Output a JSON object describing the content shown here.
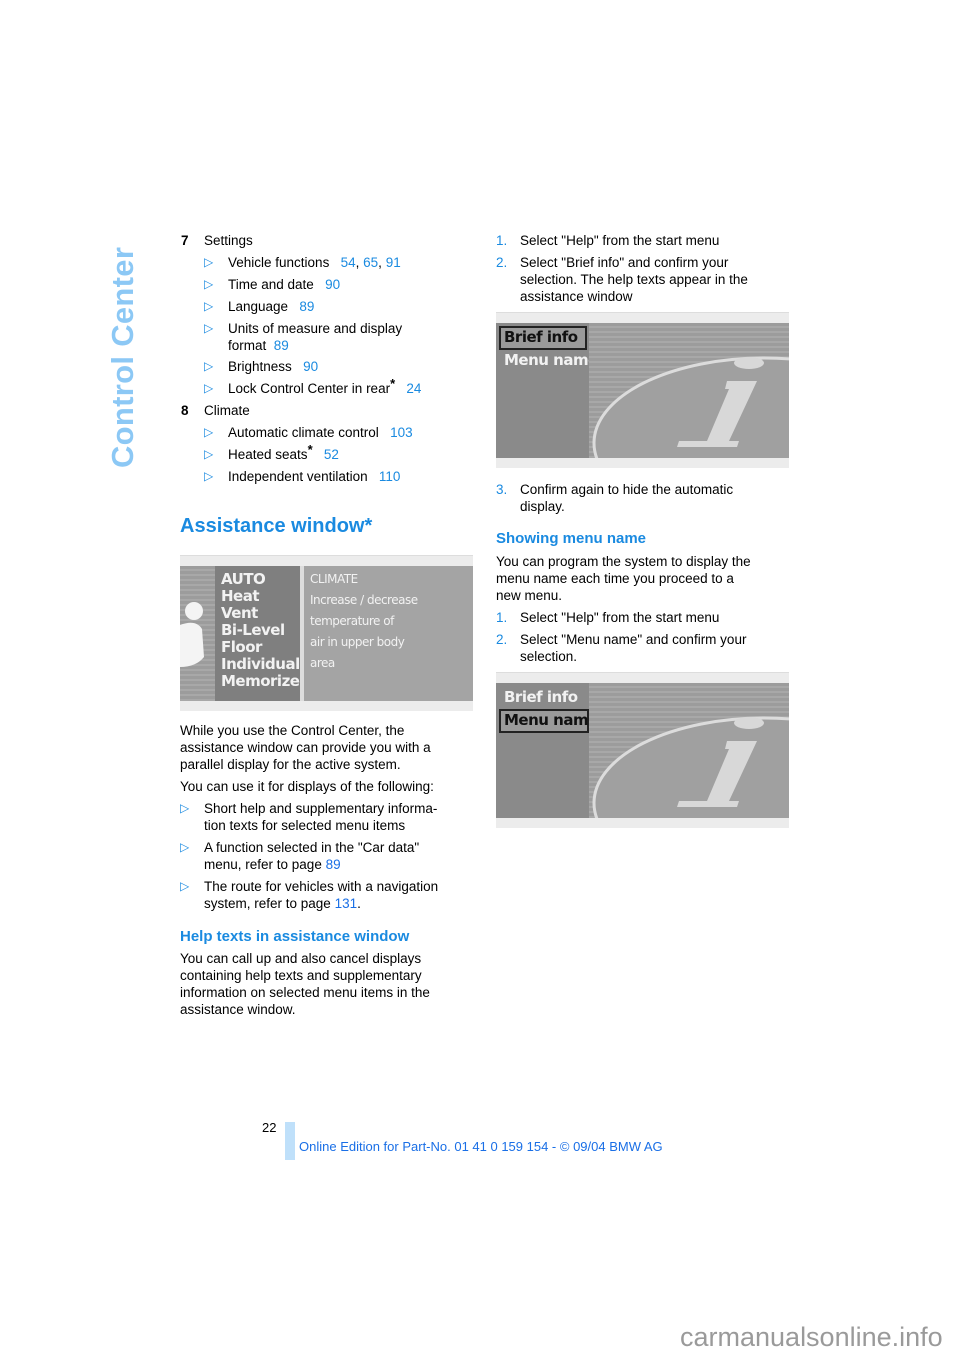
{
  "side_title": "Control Center",
  "left": {
    "items": [
      {
        "num": "7",
        "label": "Settings",
        "subitems": [
          {
            "text": "Vehicle functions",
            "refs": [
              "54",
              "65",
              "91"
            ]
          },
          {
            "text": "Time and date",
            "refs": [
              "90"
            ]
          },
          {
            "text": "Language",
            "refs": [
              "89"
            ]
          },
          {
            "text": "Units of measure and display",
            "text2": "format",
            "refs": [
              "89"
            ]
          },
          {
            "text": "Brightness",
            "refs": [
              "90"
            ]
          },
          {
            "text": "Lock Control Center in rear",
            "star": "*",
            "refs": [
              "24"
            ]
          }
        ]
      },
      {
        "num": "8",
        "label": "Climate",
        "subitems": [
          {
            "text": "Automatic climate control",
            "refs": [
              "103"
            ]
          },
          {
            "text": "Heated seats",
            "star": "*",
            "refs": [
              "52"
            ]
          },
          {
            "text": "Independent ventilation",
            "refs": [
              "110"
            ]
          }
        ]
      }
    ],
    "heading": "Assistance window*",
    "screen1": {
      "menu": [
        "AUTO",
        "Heat",
        "Vent",
        "Bi-Level",
        "Floor",
        "Individual",
        "Memorize"
      ],
      "panel": [
        "CLIMATE",
        "Increase / decrease",
        "temperature of",
        "air in upper body",
        "area"
      ]
    },
    "para1": [
      "While you use the Control Center, the",
      "assistance window can provide you with a",
      "parallel display for the active system."
    ],
    "para2": "You can use it for displays of the following:",
    "bullets": [
      {
        "l1": "Short help and supplementary informa-",
        "l2": "tion texts for selected menu items"
      },
      {
        "l1": "A function selected in the \"Car data\"",
        "l2": "menu, refer to page",
        "ref": "89"
      },
      {
        "l1": "The route for vehicles with a navigation",
        "l2": "system, refer to page",
        "ref": "131",
        "end": "."
      }
    ],
    "subheading": "Help texts in assistance window",
    "para3": [
      "You can call up and also cancel displays",
      "containing help texts and supplementary",
      "information on selected menu items in the",
      "assistance window."
    ]
  },
  "right": {
    "steps1": [
      {
        "n": "1.",
        "lines": [
          "Select \"Help\" from the start menu"
        ]
      },
      {
        "n": "2.",
        "lines": [
          "Select \"Brief info\" and confirm your",
          "selection. The help texts appear in the",
          "assistance window"
        ]
      }
    ],
    "screen2": {
      "item1": "Brief info",
      "item2": "Menu name",
      "selected": "Brief info"
    },
    "step3": {
      "n": "3.",
      "lines": [
        "Confirm again to hide the automatic",
        "display."
      ]
    },
    "heading": "Showing menu name",
    "para": [
      "You can program the system to display the",
      "menu name each time you proceed to a",
      "new menu."
    ],
    "steps2": [
      {
        "n": "1.",
        "lines": [
          "Select \"Help\" from the start menu"
        ]
      },
      {
        "n": "2.",
        "lines": [
          "Select \"Menu name\" and confirm your",
          "selection."
        ]
      }
    ],
    "screen3": {
      "item1": "Brief info",
      "item2": "Menu name",
      "selected": "Menu name"
    }
  },
  "footer": {
    "page_number": "22",
    "edition": "Online Edition for Part-No. 01 41 0 159 154 - © 09/04 BMW AG"
  },
  "watermark": "carmanualsonline.info",
  "colors": {
    "accent": "#1a8ae0",
    "side_title": "#8cc8f5",
    "footer_bar": "#bfe0fa"
  }
}
